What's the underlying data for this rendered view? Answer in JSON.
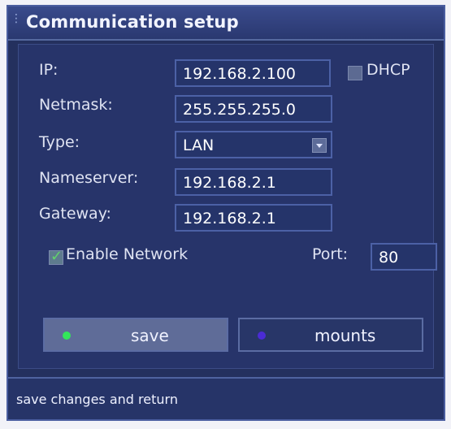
{
  "window": {
    "title": "Communication setup"
  },
  "form": {
    "ip": {
      "label": "IP:",
      "value": "192.168.2.100"
    },
    "dhcp": {
      "label": "DHCP",
      "checked": false
    },
    "netmask": {
      "label": "Netmask:",
      "value": "255.255.255.0"
    },
    "type": {
      "label": "Type:",
      "value": "LAN"
    },
    "nameserver": {
      "label": "Nameserver:",
      "value": "192.168.2.1"
    },
    "gateway": {
      "label": "Gateway:",
      "value": "192.168.2.1"
    },
    "enable_network": {
      "label": "Enable Network",
      "checked": true
    },
    "port": {
      "label": "Port:",
      "value": "80"
    }
  },
  "buttons": {
    "save": {
      "label": "save",
      "dot_color": "#33e65a"
    },
    "mounts": {
      "label": "mounts",
      "dot_color": "#4b2bd6"
    }
  },
  "status": {
    "text": "save changes and return"
  },
  "colors": {
    "background": "#24305e",
    "field_border": "#4c61a6",
    "accent_green": "#33e65a",
    "accent_blue": "#4b2bd6"
  }
}
